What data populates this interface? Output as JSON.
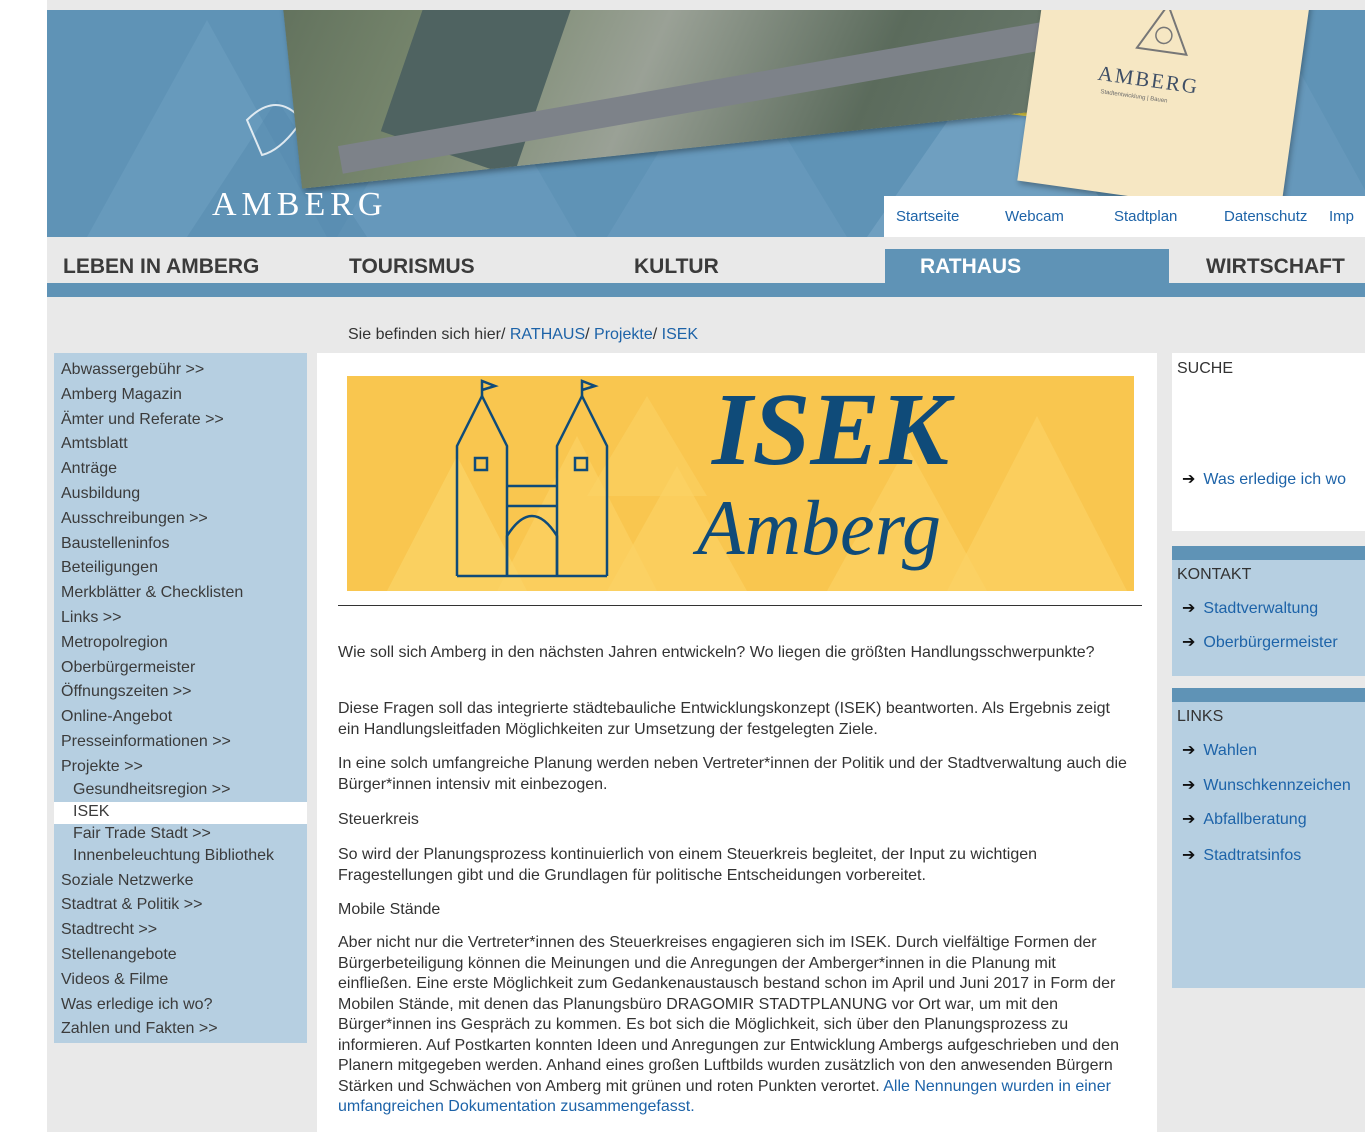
{
  "header": {
    "brand": "AMBERG",
    "card_wordmark": "AMBERG",
    "card_subline": "Stadtentwicklung | Bauen",
    "top_links": [
      "Startseite",
      "Webcam",
      "Stadtplan",
      "Datenschutz",
      "Imp"
    ]
  },
  "main_nav": [
    "LEBEN IN AMBERG",
    "TOURISMUS",
    "KULTUR",
    "RATHAUS",
    "WIRTSCHAFT"
  ],
  "breadcrumb": {
    "prefix": "Sie befinden sich hier/ ",
    "items": [
      "RATHAUS",
      "Projekte",
      "ISEK"
    ]
  },
  "sidebar": {
    "items": [
      "Abwassergebühr >>",
      "Amberg Magazin",
      "Ämter und Referate >>",
      "Amtsblatt",
      "Anträge",
      "Ausbildung",
      "Ausschreibungen >>",
      "Baustelleninfos",
      "Beteiligungen",
      "Merkblätter & Checklisten",
      "Links >>",
      "Metropolregion",
      "Oberbürgermeister",
      "Öffnungszeiten >>",
      "Online-Angebot",
      "Presseinformationen >>",
      "Projekte >>"
    ],
    "sub_items": [
      "Gesundheitsregion >>",
      "ISEK",
      "Fair Trade Stadt >>",
      "Innenbeleuchtung Bibliothek"
    ],
    "items_after": [
      "Soziale Netzwerke",
      "Stadtrat & Politik >>",
      "Stadtrecht >>",
      "Stellenangebote",
      "Videos & Filme",
      "Was erledige ich wo?",
      "Zahlen und Fakten >>"
    ]
  },
  "banner": {
    "title": "ISEK",
    "subtitle": "Amberg",
    "colors": {
      "background": "#f9c64f",
      "text": "#0f4b79"
    }
  },
  "content": {
    "intro": "Wie soll sich Amberg in den nächsten Jahren entwickeln? Wo liegen die größten Handlungsschwerpunkte?",
    "p2": "Diese Fragen soll das integrierte städtebauliche Entwicklungskonzept (ISEK) beantworten. Als Ergebnis zeigt ein Handlungsleitfaden Möglichkeiten zur Umsetzung der festgelegten Ziele.",
    "p3": "In eine solch umfangreiche Planung werden neben Vertreter*innen der Politik und der Stadtverwaltung auch die Bürger*innen intensiv mit einbezogen.",
    "h_steuerkreis": "Steuerkreis",
    "p4": "So wird der Planungsprozess kontinuierlich von einem Steuerkreis begleitet, der Input zu wichtigen Fragestellungen gibt und die Grundlagen für politische Entscheidungen vorbereitet.",
    "h_mobile": "Mobile Stände",
    "p5": "Aber nicht nur die Vertreter*innen des Steuerkreises engagieren sich im ISEK. Durch vielfältige Formen der Bürgerbeteiligung können die Meinungen und die Anregungen der Amberger*innen in die Planung mit einfließen. Eine erste Möglichkeit zum Gedankenaustausch bestand schon im April und Juni 2017 in Form der Mobilen Stände, mit denen das Planungsbüro DRAGOMIR STADTPLANUNG vor Ort war, um mit den Bürger*innen ins Gespräch zu kommen. Es bot sich die Möglichkeit, sich über den Planungsprozess zu informieren. Auf Postkarten konnten Ideen und Anregungen zur Entwicklung Ambergs aufgeschrieben und den Planern mitgegeben werden. Anhand eines großen Luftbilds wurden zusätzlich von den anwesenden Bürgern Stärken und Schwächen von Amberg mit grünen und roten Punkten verortet. ",
    "p5_link": "Alle Nennungen wurden in einer umfangreichen Dokumentation zusammengefasst."
  },
  "right": {
    "search_title": "SUCHE",
    "search_link": "Was erledige ich wo",
    "contact_title": "KONTAKT",
    "contact_links": [
      "Stadtverwaltung",
      "Oberbürgermeister"
    ],
    "links_title": "LINKS",
    "links": [
      "Wahlen",
      "Wunschkennzeichen",
      "Abfallberatung",
      "Stadtratsinfos"
    ],
    "arrow": "➔"
  },
  "colors": {
    "accent": "#5f93b6",
    "sidebar": "#b6cfe1",
    "link": "#1d63a8"
  }
}
